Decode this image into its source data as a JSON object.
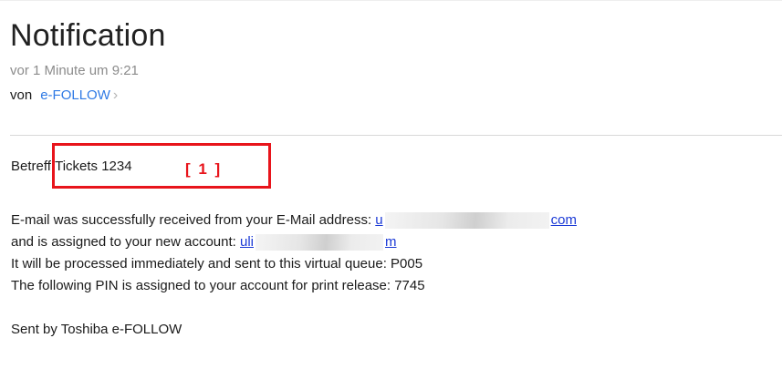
{
  "header": {
    "title": "Notification",
    "timestamp": "vor 1 Minute um 9:21",
    "from_prefix": "von",
    "sender": "e-FOLLOW",
    "chevron": "›"
  },
  "message": {
    "subject": "Betreff:Tickets 1234",
    "annotation_label": "[ 1 ]",
    "annotation_color": "#e8141b",
    "line1_text": "E-mail was successfully received from your E-Mail address: ",
    "line1_link_start": "u",
    "line1_link_end": "com",
    "line2_text": "and is assigned to your new account: ",
    "line2_link_start": "uli",
    "line2_link_end": "m",
    "line3": "It will be processed immediately and sent to this virtual queue: P005",
    "line4": "The following PIN is assigned to your account for print release: 7745",
    "signature": "Sent by Toshiba e-FOLLOW"
  },
  "colors": {
    "link": "#1a39d6",
    "sender": "#2f7ae5",
    "muted": "#8c8c8c"
  }
}
